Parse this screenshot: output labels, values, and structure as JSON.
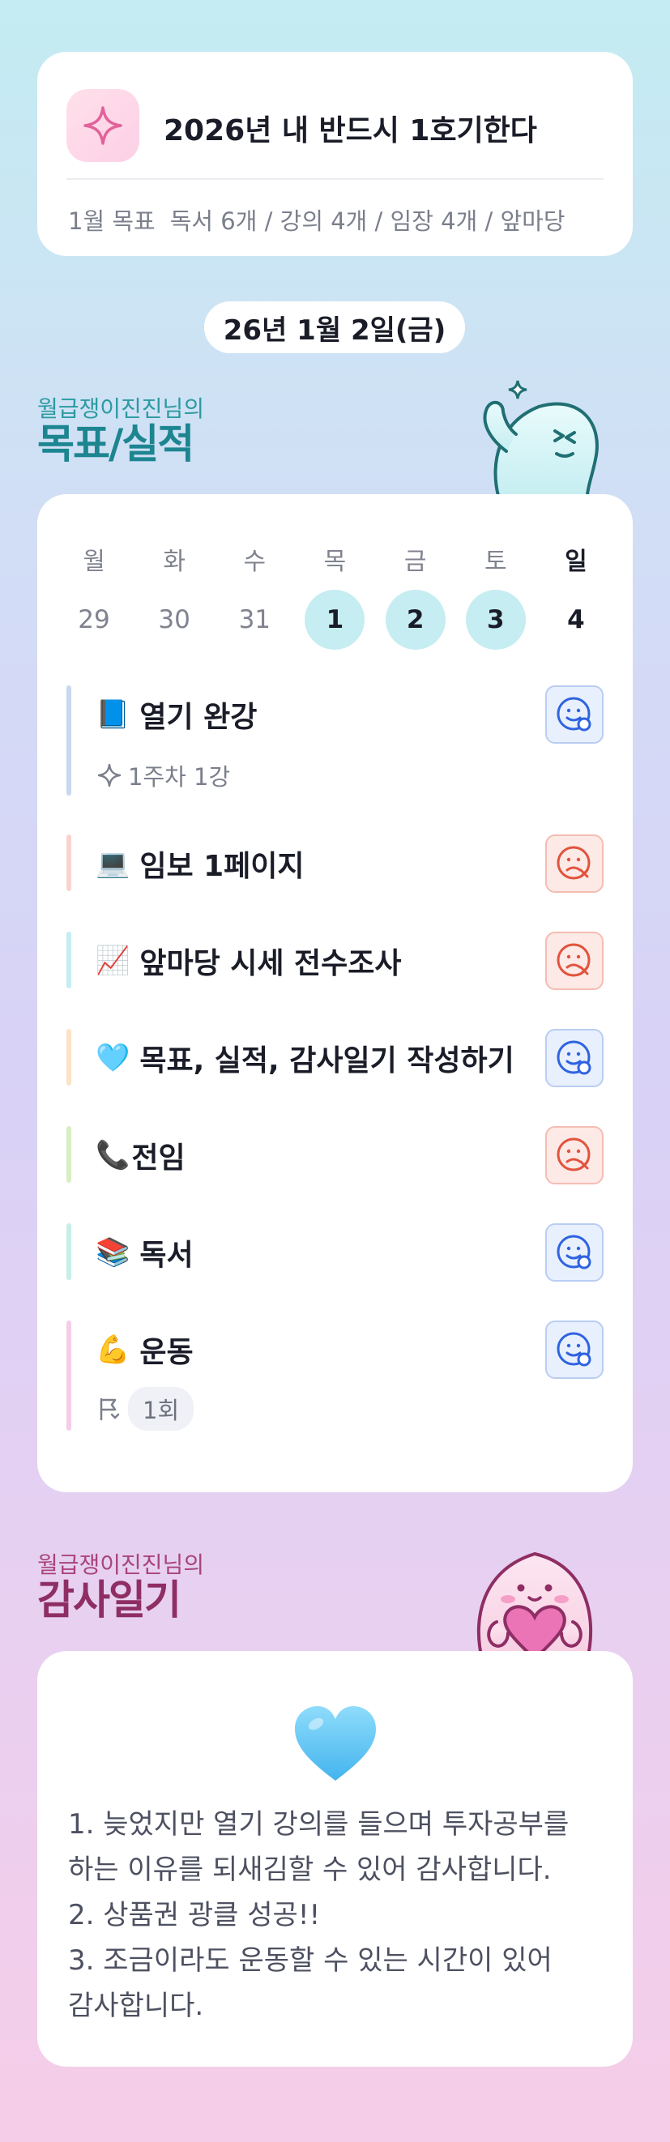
{
  "goal": {
    "icon": "sparkle-icon",
    "title": "2026년 내 반드시 1호기한다",
    "sub_label": "1월 목표",
    "sub_value": "독서 6개 / 강의 4개 / 임장 4개 / 앞마당"
  },
  "date_label": "26년 1월 2일(금)",
  "progress_section": {
    "subtitle": "월급쟁이진진님의",
    "title": "목표/실적"
  },
  "week": {
    "days_of_week": [
      "월",
      "화",
      "수",
      "목",
      "금",
      "토",
      "일"
    ],
    "dates": [
      "29",
      "30",
      "31",
      "1",
      "2",
      "3",
      "4"
    ],
    "done_dates": [
      "1",
      "2",
      "3"
    ]
  },
  "tasks": [
    {
      "emoji": "📘",
      "name": "열기 완강",
      "meta_icon": "sparkle-outline-icon",
      "meta": "1주차 1강",
      "status": "success",
      "bar_color": "#c9d8ee"
    },
    {
      "emoji": "💻",
      "name": "임보 1페이지",
      "status": "fail",
      "bar_color": "#f9d3cd"
    },
    {
      "emoji": "📈",
      "name": "앞마당 시세 전수조사",
      "status": "fail",
      "bar_color": "#c3eef2"
    },
    {
      "emoji": "🩵",
      "name": "목표, 실적, 감사일기 작성하기",
      "status": "success",
      "bar_color": "#fbe3c6"
    },
    {
      "emoji": "📞",
      "name": "전임",
      "status": "fail",
      "bar_color": "#d7efc2"
    },
    {
      "emoji": "📚",
      "name": "독서",
      "status": "success",
      "bar_color": "#c5efe8"
    },
    {
      "emoji": "💪",
      "name": "운동",
      "meta_icon": "flag-icon",
      "meta": "1회",
      "status": "success",
      "bar_color": "#f6cde6"
    }
  ],
  "gratitude_section": {
    "subtitle": "월급쟁이진진님의",
    "title": "감사일기",
    "heart_icon": "light-blue-heart-icon",
    "lines": [
      "1. 늦었지만 열기 강의를 들으며 투자공부를",
      "하는 이유를 되새김할 수 있어 감사합니다.",
      "2. 상품권 광클 성공!!",
      "3. 조금이라도 운동할 수 있는 시간이 있어",
      "감사합니다."
    ]
  }
}
